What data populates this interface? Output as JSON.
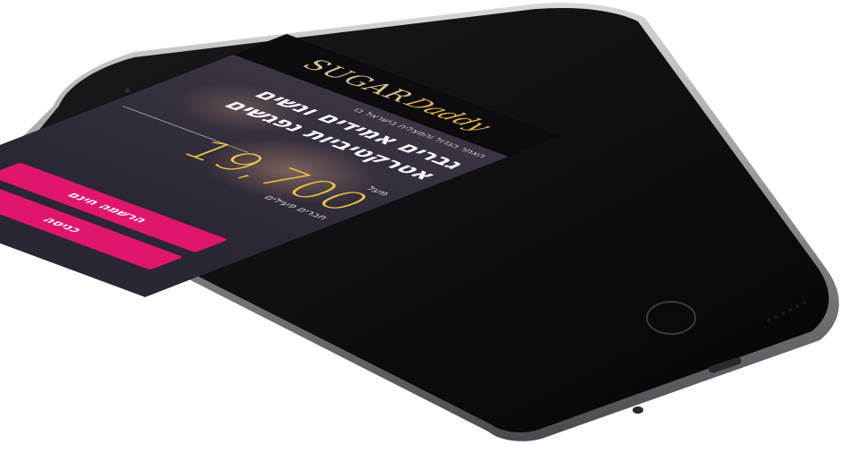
{
  "logo": {
    "part1": "SUGAR",
    "part2": "Daddy"
  },
  "hero": {
    "tagline": "האתר הגדול והמצליח בישראל בו",
    "headline_line1": "גברים אמידים ונשים",
    "headline_line2": "אטרקטיביות נפגשים",
    "count_above": "מעל",
    "count_value": "19,700",
    "count_below": "חברים פעילים"
  },
  "actions": {
    "register_label": "הרשמה חינם",
    "login_label": "כניסה"
  },
  "colors": {
    "accent": "#e0166e",
    "gold": "#f0c548",
    "screen_bg": "#2b2736",
    "phone_body": "#5a5a5e"
  },
  "icons": [
    "home-button-icon",
    "speaker-grille-icon",
    "lightning-port-icon",
    "headphone-jack-icon",
    "camera-icon",
    "volume-button-icon",
    "mute-switch-icon"
  ]
}
